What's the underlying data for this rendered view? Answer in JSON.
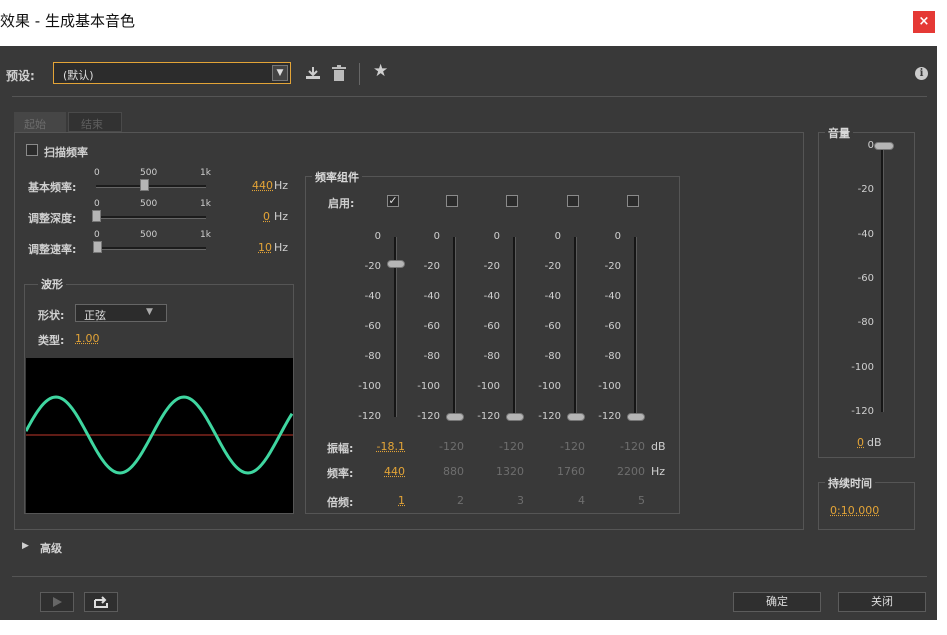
{
  "window": {
    "title": "效果 - 生成基本音色",
    "close_glyph": "×"
  },
  "toolbar": {
    "preset_label": "预设:",
    "preset_value": "(默认)",
    "info_glyph": "i"
  },
  "tabs": [
    {
      "label": "起始"
    },
    {
      "label": "结束"
    }
  ],
  "sweep": {
    "label": "扫描频率"
  },
  "params": {
    "base_freq": {
      "label": "基本频率:",
      "value": "440",
      "unit": "Hz",
      "fraction": 0.44
    },
    "mod_depth": {
      "label": "调整深度:",
      "value": "0",
      "unit": "Hz",
      "fraction": 0
    },
    "mod_rate": {
      "label": "调整速率:",
      "value": "10",
      "unit": "Hz",
      "fraction": 0.01
    },
    "scale": [
      "0",
      "500",
      "1k"
    ]
  },
  "waveform": {
    "legend": "波形",
    "shape_label": "形状:",
    "shape_value": "正弦",
    "type_label": "类型:",
    "type_value": "1.00"
  },
  "components": {
    "legend": "频率组件",
    "enable_label": "启用:",
    "ticks": [
      "0",
      "-20",
      "-40",
      "-60",
      "-80",
      "-100",
      "-120"
    ],
    "amp_label": "振幅:",
    "freq_label": "频率:",
    "mult_label": "倍频:",
    "db_unit": "dB",
    "hz_unit": "Hz",
    "columns": [
      {
        "enabled": true,
        "check": "✓",
        "amp": "-18.1",
        "freq": "440",
        "mult": "1",
        "level": -18.1
      },
      {
        "enabled": false,
        "check": "",
        "amp": "-120",
        "freq": "880",
        "mult": "2",
        "level": -120
      },
      {
        "enabled": false,
        "check": "",
        "amp": "-120",
        "freq": "1320",
        "mult": "3",
        "level": -120
      },
      {
        "enabled": false,
        "check": "",
        "amp": "-120",
        "freq": "1760",
        "mult": "4",
        "level": -120
      },
      {
        "enabled": false,
        "check": "",
        "amp": "-120",
        "freq": "2200",
        "mult": "5",
        "level": -120
      }
    ]
  },
  "volume": {
    "legend": "音量",
    "ticks": [
      "0",
      "-20",
      "-40",
      "-60",
      "-80",
      "-100",
      "-120"
    ],
    "value": "0",
    "unit": "dB",
    "level": 0
  },
  "duration": {
    "legend": "持续时间",
    "value": "0:10.000"
  },
  "advanced": {
    "label": "高级",
    "arrow": "▶"
  },
  "footer": {
    "ok_label": "确定",
    "close_label": "关闭"
  },
  "colors": {
    "accent": "#e3a437",
    "wave": "#3fd6a0",
    "zero_line": "#c0392b",
    "close_bg": "#e53935"
  }
}
